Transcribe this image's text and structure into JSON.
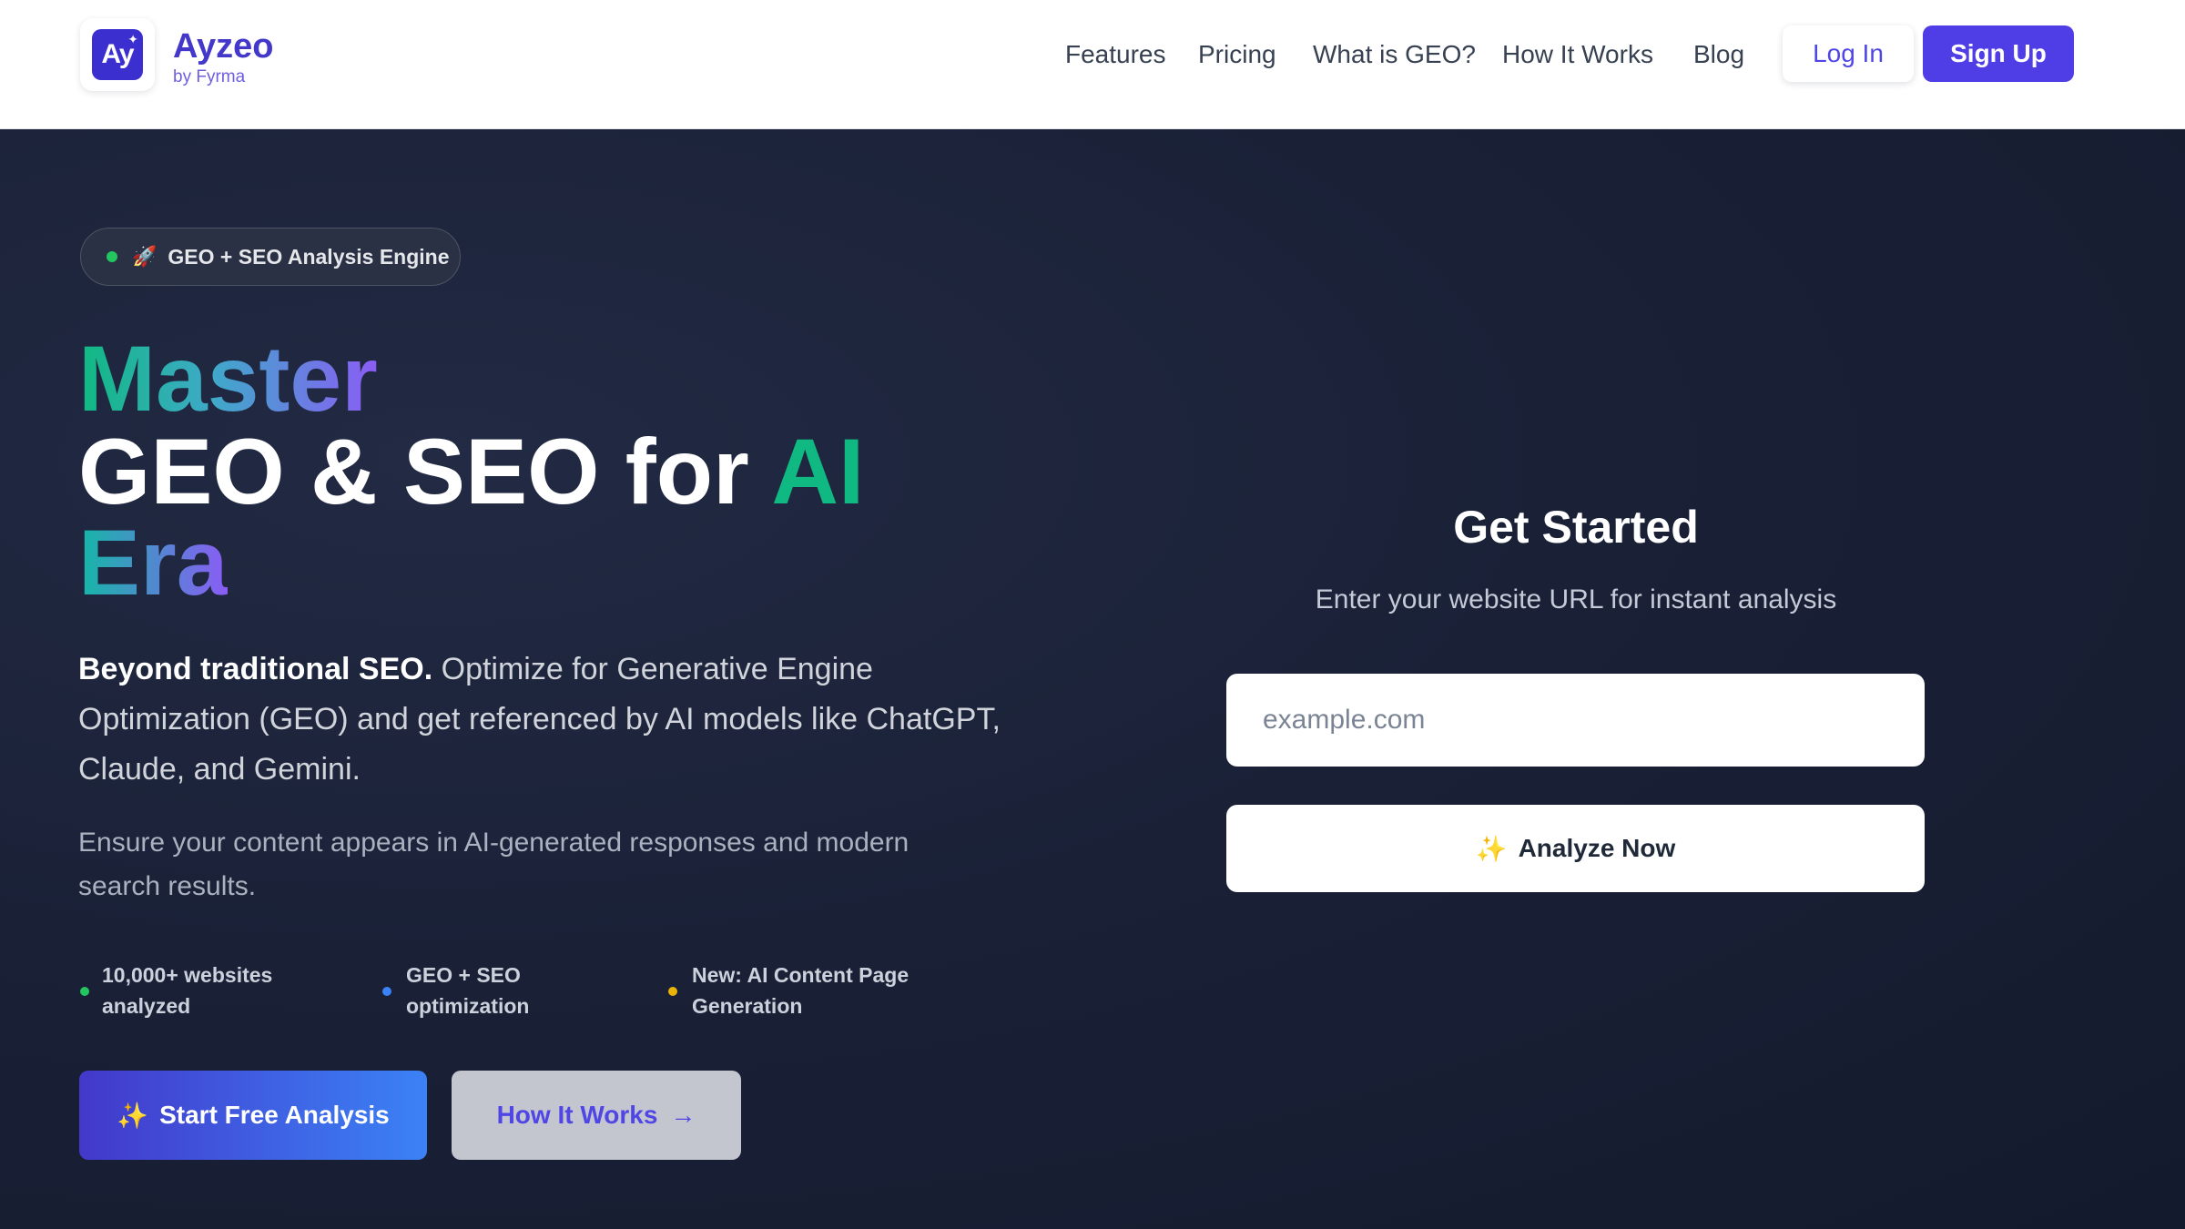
{
  "brand": {
    "logo_text": "Ay",
    "name": "Ayzeo",
    "tagline": "by Fyrma"
  },
  "nav": {
    "links": [
      "Features",
      "Pricing",
      "What is GEO?",
      "How It Works",
      "Blog"
    ],
    "login_label": "Log In",
    "signup_label": "Sign Up"
  },
  "hero": {
    "badge_icon": "🚀",
    "badge_text": "GEO + SEO Analysis Engine",
    "headline_line1": "Master",
    "headline_line2_main": "GEO & SEO for ",
    "headline_line2_accent": "AI",
    "headline_line3": "Era",
    "desc_bold": "Beyond traditional SEO.",
    "desc_rest": " Optimize for Generative Engine Optimization (GEO) and get referenced by AI models like ChatGPT, Claude, and Gemini.",
    "desc2": "Ensure your content appears in AI-generated responses and modern search results.",
    "features": [
      {
        "line1": "10,000+ websites",
        "line2": "analyzed"
      },
      {
        "line1": "GEO + SEO",
        "line2": "optimization"
      },
      {
        "line1": "New: AI Content Page",
        "line2": "Generation"
      }
    ],
    "start_label": "Start Free Analysis",
    "how_label": "How It Works",
    "sparkle_icon": "✨",
    "arrow_icon": "→"
  },
  "get_started": {
    "title": "Get Started",
    "subtitle": "Enter your website URL for instant analysis",
    "input_placeholder": "example.com",
    "input_value": "",
    "analyze_label": "Analyze Now"
  },
  "colors": {
    "brand_indigo": "#4f3de6",
    "dot_green": "#22c55e",
    "dot_blue": "#3b82f6",
    "dot_amber": "#eab308",
    "accent_teal": "#10b981"
  }
}
